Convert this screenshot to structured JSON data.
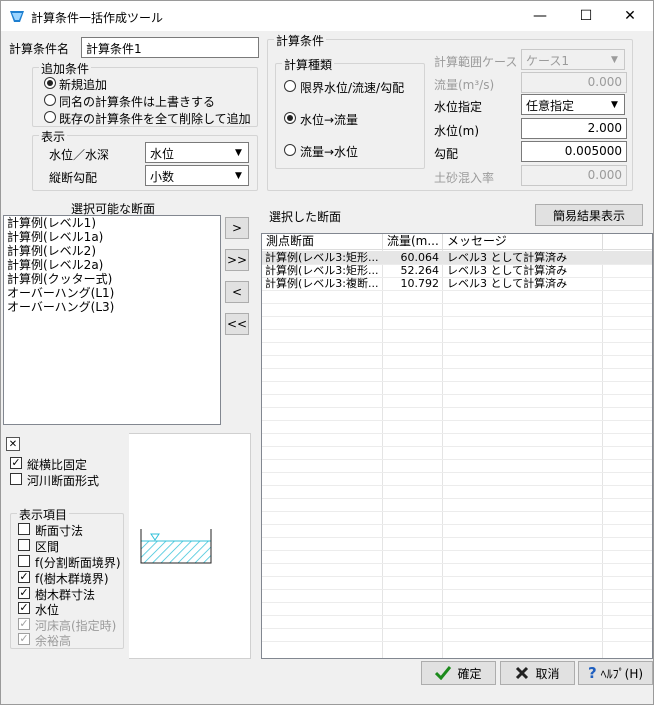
{
  "window": {
    "title": "計算条件一括作成ツール",
    "minimize": "—",
    "maximize": "☐",
    "close": "✕"
  },
  "top": {
    "name_label": "計算条件名",
    "name_value": "計算条件1"
  },
  "additional": {
    "title": "追加条件",
    "options": [
      "新規追加",
      "同名の計算条件は上書きする",
      "既存の計算条件を全て削除して追加"
    ],
    "selected": 0
  },
  "display": {
    "title": "表示",
    "level_label": "水位／水深",
    "level_value": "水位",
    "slope_label": "縦断勾配",
    "slope_value": "小数"
  },
  "calc": {
    "title": "計算条件",
    "type_title": "計算種類",
    "types": [
      "限界水位/流速/勾配",
      "水位→流量",
      "流量→水位"
    ],
    "selected": 1,
    "range_label": "計算範囲ケース",
    "range_value": "ケース1",
    "flow_label": "流量(m³/s)",
    "flow_value": "0.000",
    "wl_spec_label": "水位指定",
    "wl_spec_value": "任意指定",
    "wl_label": "水位(m)",
    "wl_value": "2.000",
    "slope_label": "勾配",
    "slope_value": "0.005000",
    "sediment_label": "土砂混入率",
    "sediment_value": "0.000"
  },
  "available": {
    "title": "選択可能な断面",
    "items": [
      "計算例(レベル1)",
      "計算例(レベル1a)",
      "計算例(レベル2)",
      "計算例(レベル2a)",
      "計算例(クッター式)",
      "オーバーハング(L1)",
      "オーバーハング(L3)"
    ]
  },
  "transfer": {
    "add": ">",
    "add_all": ">>",
    "remove": "<",
    "remove_all": "<<"
  },
  "selected": {
    "title": "選択した断面",
    "quick_button": "簡易結果表示",
    "columns": [
      "測点断面",
      "流量(m...",
      "メッセージ"
    ],
    "rows": [
      {
        "name": "計算例(レベル3:矩形...",
        "flow": "60.064",
        "message": "レベル3 として計算済み"
      },
      {
        "name": "計算例(レベル3:矩形...",
        "flow": "52.264",
        "message": "レベル3 として計算済み"
      },
      {
        "name": "計算例(レベル3:複断...",
        "flow": "10.792",
        "message": "レベル3 として計算済み"
      }
    ]
  },
  "preview": {
    "close": "✕",
    "aspect_fixed": "縦横比固定",
    "river_shape": "河川断面形式",
    "items_title": "表示項目",
    "items": [
      {
        "label": "断面寸法",
        "checked": false,
        "disabled": false
      },
      {
        "label": "区間",
        "checked": false,
        "disabled": false
      },
      {
        "label": "f(分割断面境界)",
        "checked": false,
        "disabled": false
      },
      {
        "label": "f(樹木群境界)",
        "checked": true,
        "disabled": false
      },
      {
        "label": "樹木群寸法",
        "checked": true,
        "disabled": false
      },
      {
        "label": "水位",
        "checked": true,
        "disabled": false
      },
      {
        "label": "河床高(指定時)",
        "checked": true,
        "disabled": true
      },
      {
        "label": "余裕高",
        "checked": true,
        "disabled": true
      }
    ]
  },
  "buttons": {
    "ok": "確定",
    "cancel": "取消",
    "help": "ﾍﾙﾌﾟ(H)"
  },
  "colors": {
    "ok_check": "#1c8a1c",
    "cancel_x": "#222",
    "help_q": "#1f5fbf",
    "water": "#30c0d8",
    "title_icon": "#1e7fd0"
  }
}
